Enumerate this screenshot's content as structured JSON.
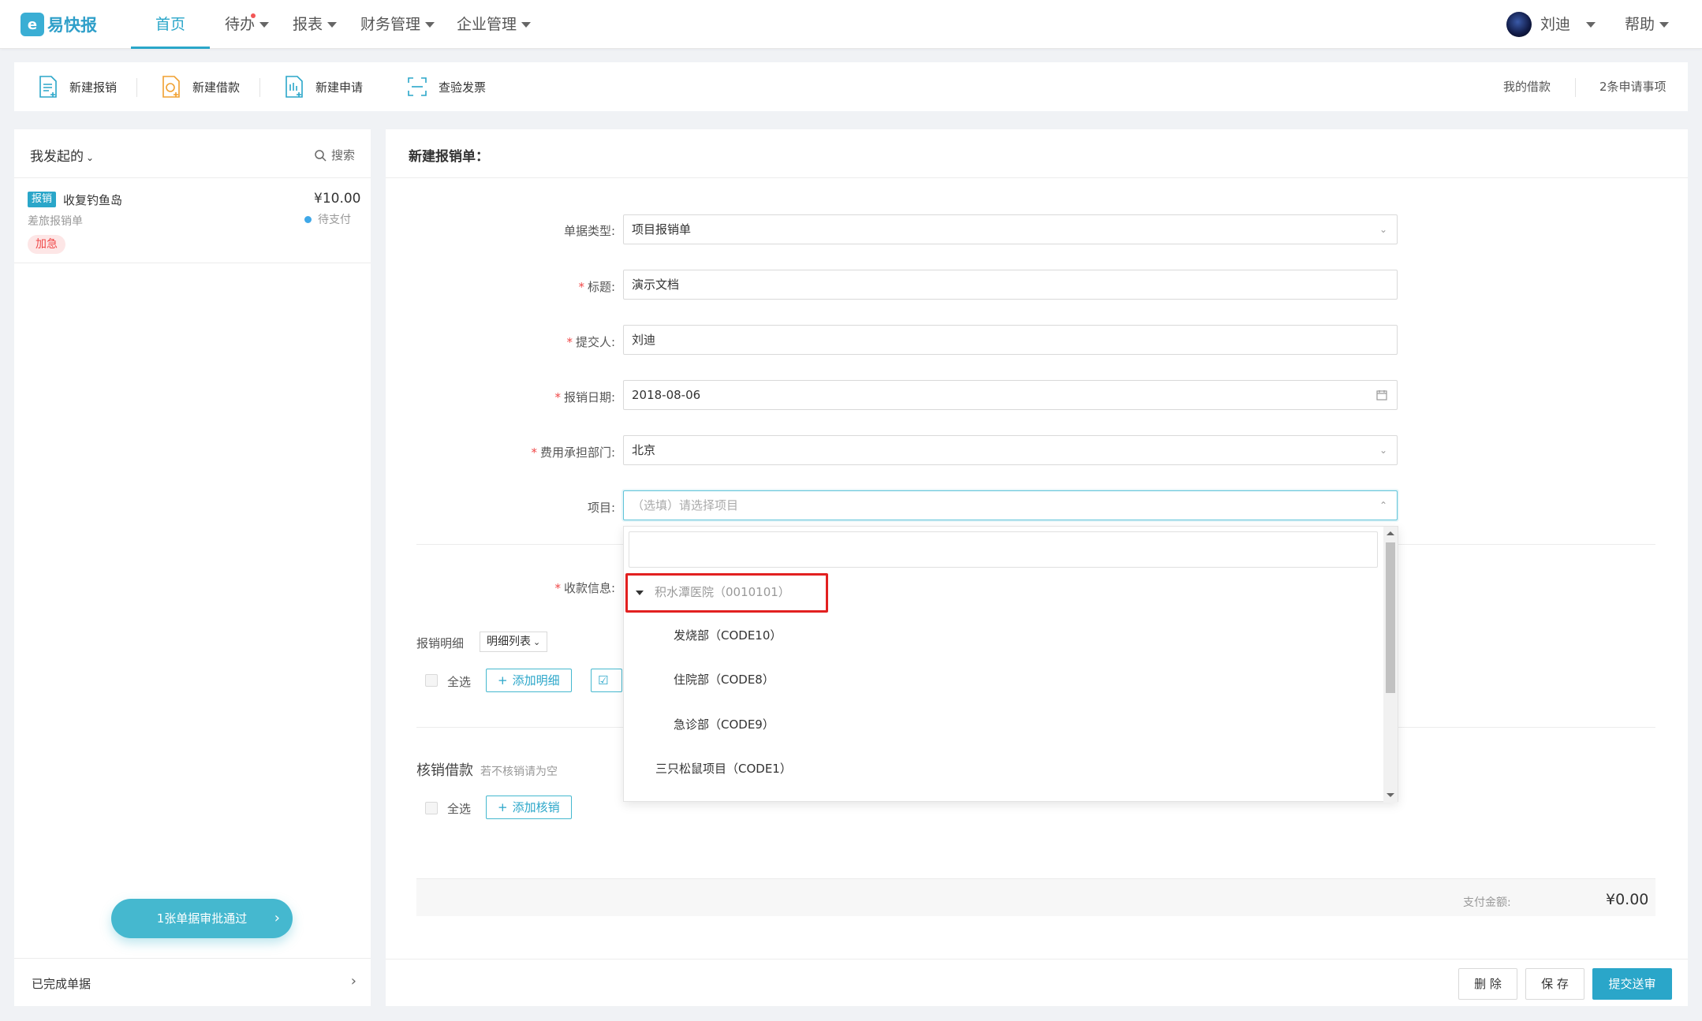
{
  "app": {
    "logo_text": "易快报",
    "logo_glyph": "e"
  },
  "nav": {
    "items": [
      {
        "label": "首页"
      },
      {
        "label": "待办"
      },
      {
        "label": "报表"
      },
      {
        "label": "财务管理"
      },
      {
        "label": "企业管理"
      }
    ],
    "user_name": "刘迪",
    "help": "帮助"
  },
  "toolbar": {
    "new_expense": "新建报销",
    "new_loan": "新建借款",
    "new_request": "新建申请",
    "check_invoice": "查验发票",
    "my_loans": "我的借款",
    "pending_requests": "2条申请事项"
  },
  "left_panel": {
    "title": "我发起的",
    "search": "搜索",
    "item": {
      "tag": "报销",
      "title": "收复钓鱼岛",
      "amount": "¥10.00",
      "subtitle": "差旅报销单",
      "status": "待支付",
      "urgent": "加急"
    },
    "approve_button": "1张单据审批通过",
    "completed": "已完成单据"
  },
  "form": {
    "title": "新建报销单：",
    "doc_type_label": "单据类型:",
    "doc_type_value": "项目报销单",
    "title_label": "标题:",
    "title_value": "演示文档",
    "submitter_label": "提交人:",
    "submitter_value": "刘迪",
    "date_label": "报销日期:",
    "date_value": "2018-08-06",
    "dept_label": "费用承担部门:",
    "dept_value": "北京",
    "project_label": "项目:",
    "project_placeholder": "（选填）请选择项目",
    "payee_label": "收款信息:",
    "details_label": "报销明细",
    "details_select": "明细列表",
    "select_all": "全选",
    "add_detail": "添加明细",
    "loan_section": "核销借款",
    "loan_hint": "若不核销请为空",
    "add_writeoff": "添加核销",
    "pay_label": "支付金额:",
    "pay_amount": "¥0.00"
  },
  "dropdown": {
    "tree": [
      {
        "label": "积水潭医院（0010101）"
      },
      {
        "label": "发烧部（CODE10）"
      },
      {
        "label": "住院部（CODE8）"
      },
      {
        "label": "急诊部（CODE9）"
      },
      {
        "label": "三只松鼠项目（CODE1）"
      }
    ]
  },
  "actions": {
    "delete": "删 除",
    "save": "保 存",
    "submit": "提交送审"
  },
  "colors": {
    "accent": "#2aa6c9",
    "required": "#f04848",
    "highlight": "#e22020"
  }
}
